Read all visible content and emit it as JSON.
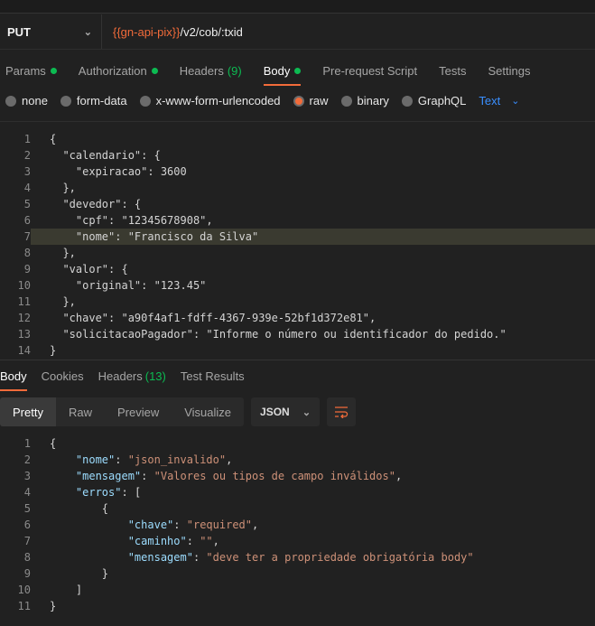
{
  "request": {
    "method": "PUT",
    "url_variable": "{{gn-api-pix}}",
    "url_path": "/v2/cob/:txid"
  },
  "request_tabs": [
    {
      "label": "Params",
      "dot": true
    },
    {
      "label": "Authorization",
      "dot": true
    },
    {
      "label": "Headers",
      "count": "(9)"
    },
    {
      "label": "Body",
      "dot": true,
      "active": true
    },
    {
      "label": "Pre-request Script"
    },
    {
      "label": "Tests"
    },
    {
      "label": "Settings"
    }
  ],
  "body_options": [
    {
      "label": "none"
    },
    {
      "label": "form-data"
    },
    {
      "label": "x-www-form-urlencoded"
    },
    {
      "label": "raw",
      "selected": true
    },
    {
      "label": "binary"
    },
    {
      "label": "GraphQL"
    }
  ],
  "body_format": "Text",
  "request_body": [
    "{",
    "  \"calendario\": {",
    "    \"expiracao\": 3600",
    "  },",
    "  \"devedor\": {",
    "    \"cpf\": \"12345678908\",",
    "    \"nome\": \"Francisco da Silva\"",
    "  },",
    "  \"valor\": {",
    "    \"original\": \"123.45\"",
    "  },",
    "  \"chave\": \"a90f4af1-fdff-4367-939e-52bf1d372e81\",",
    "  \"solicitacaoPagador\": \"Informe o número ou identificador do pedido.\"",
    "}"
  ],
  "response_tabs": [
    {
      "label": "Body",
      "active": true
    },
    {
      "label": "Cookies"
    },
    {
      "label": "Headers",
      "count": "(13)"
    },
    {
      "label": "Test Results"
    }
  ],
  "view_modes": [
    "Pretty",
    "Raw",
    "Preview",
    "Visualize"
  ],
  "response_format": "JSON",
  "response_body": [
    "{",
    "    \"nome\": \"json_invalido\",",
    "    \"mensagem\": \"Valores ou tipos de campo inválidos\",",
    "    \"erros\": [",
    "        {",
    "            \"chave\": \"required\",",
    "            \"caminho\": \"\",",
    "            \"mensagem\": \"deve ter a propriedade obrigatória body\"",
    "        }",
    "    ]",
    "}"
  ],
  "colors": {
    "accent": "#f26b3a",
    "status_dot": "#0cbb52",
    "link": "#3a8fff",
    "json_key": "#9cdcfe",
    "json_string": "#ce9178"
  }
}
